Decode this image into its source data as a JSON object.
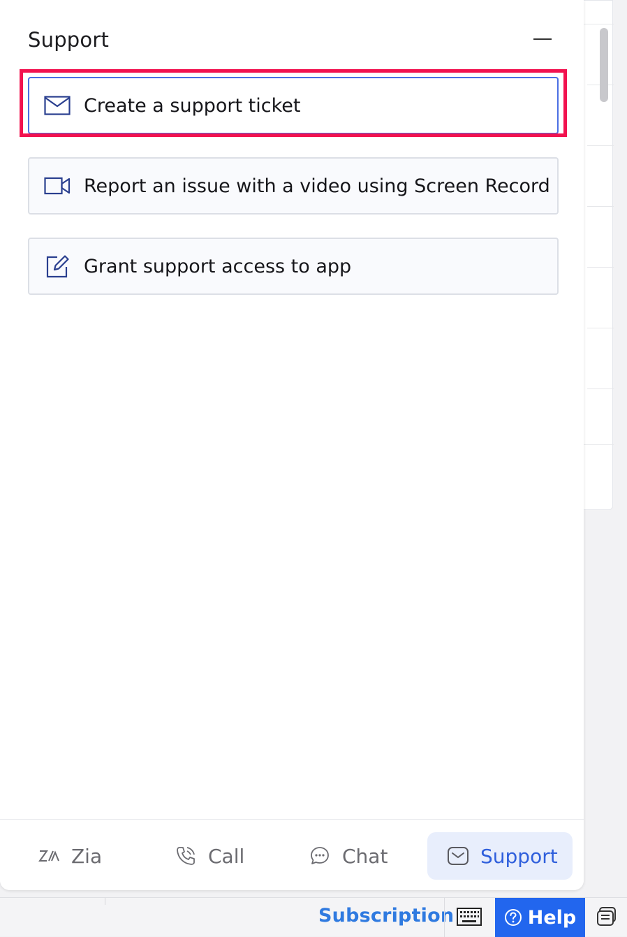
{
  "panel": {
    "title": "Support",
    "minimize_icon": "minimize-icon"
  },
  "options": [
    {
      "label": "Create a support ticket",
      "icon": "mail-icon",
      "selected": true
    },
    {
      "label": "Report an issue with a video using Screen Record",
      "icon": "video-camera-icon",
      "selected": false
    },
    {
      "label": "Grant support access to app",
      "icon": "edit-icon",
      "selected": false
    }
  ],
  "tabs": [
    {
      "label": "Zia",
      "icon": "zia-icon",
      "active": false
    },
    {
      "label": "Call",
      "icon": "phone-icon",
      "active": false
    },
    {
      "label": "Chat",
      "icon": "chat-icon",
      "active": false
    },
    {
      "label": "Support",
      "icon": "support-icon",
      "active": true
    }
  ],
  "statusbar": {
    "subscription_label": "Subscription",
    "help_label": "Help",
    "keyboard_icon": "keyboard-icon",
    "notes_icon": "notes-icon"
  },
  "colors": {
    "accent": "#2266ee",
    "highlight": "#f2124f",
    "link": "#2f7ae0"
  }
}
